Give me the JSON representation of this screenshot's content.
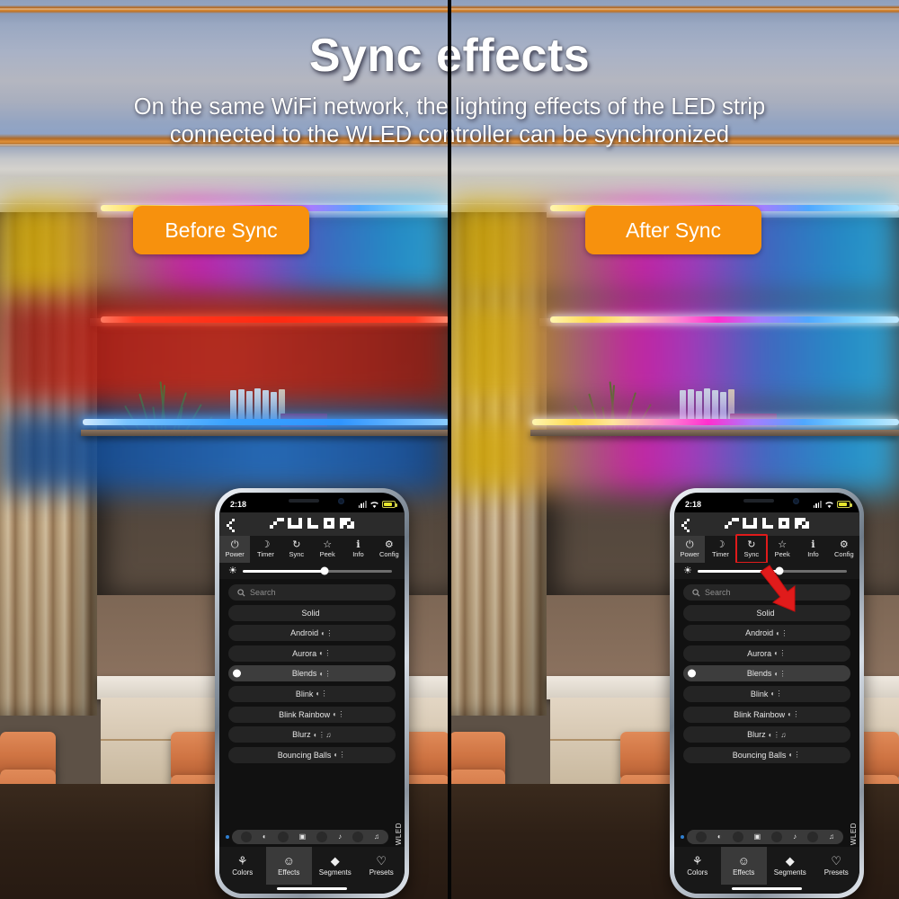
{
  "header": {
    "title": "Sync effects",
    "subtitle_line1": "On the same WiFi network, the lighting effects of the LED strip",
    "subtitle_line2": "connected to the WLED controller can be synchronized"
  },
  "badges": {
    "before": "Before Sync",
    "after": "After Sync"
  },
  "colors": {
    "badge_orange": "#f7910d",
    "divider_black": "#050505",
    "arrow_red": "#e01b1b",
    "highlight_red": "#e01b1b",
    "app_background": "#111111",
    "toolbar_background": "#181818",
    "active_tab": "#3a3a3a"
  },
  "phone": {
    "status_bar": {
      "time": "2:18",
      "signal_icon": "cellular-signal-icon",
      "wifi_icon": "wifi-icon",
      "battery_icon": "battery-icon"
    },
    "app_bar": {
      "back_icon": "back-chevron-icon",
      "logo_text": "WLED"
    },
    "toolbar": [
      {
        "label": "Power",
        "icon": "power-icon",
        "glyph": "⏻",
        "active": true
      },
      {
        "label": "Timer",
        "icon": "moon-icon",
        "glyph": "☽",
        "active": false
      },
      {
        "label": "Sync",
        "icon": "sync-icon",
        "glyph": "↻",
        "active": false
      },
      {
        "label": "Peek",
        "icon": "star-icon",
        "glyph": "☆",
        "active": false
      },
      {
        "label": "Info",
        "icon": "info-icon",
        "glyph": "ℹ",
        "active": false
      },
      {
        "label": "Config",
        "icon": "gear-icon",
        "glyph": "⚙",
        "active": false
      }
    ],
    "brightness": {
      "icon": "brightness-gear-icon",
      "value_percent": 55
    },
    "search": {
      "placeholder": "Search",
      "icon": "search-icon"
    },
    "effects": [
      {
        "name": "Solid",
        "tags": "",
        "selected": false
      },
      {
        "name": "Android",
        "tags": "◐⋮",
        "selected": false
      },
      {
        "name": "Aurora",
        "tags": "◐⋮",
        "selected": false
      },
      {
        "name": "Blends",
        "tags": "◐⋮",
        "selected": true
      },
      {
        "name": "Blink",
        "tags": "◐⋮",
        "selected": false
      },
      {
        "name": "Blink Rainbow",
        "tags": "◐⋮",
        "selected": false
      },
      {
        "name": "Blurz",
        "tags": "◐⋮♫",
        "selected": false
      },
      {
        "name": "Bouncing Balls",
        "tags": "◐⋮",
        "selected": false
      }
    ],
    "filter_bar": {
      "icons": [
        "palette-filter-icon",
        "square-filter-icon",
        "note-filter-icon",
        "music-filter-icon"
      ],
      "glyphs": [
        "◐",
        "▣",
        "♪",
        "♫"
      ]
    },
    "side_label": "WLED",
    "nav": [
      {
        "label": "Colors",
        "icon": "palette-icon",
        "glyph": "⚘",
        "active": false
      },
      {
        "label": "Effects",
        "icon": "smiley-icon",
        "glyph": "☺",
        "active": true
      },
      {
        "label": "Segments",
        "icon": "layers-icon",
        "glyph": "◆",
        "active": false
      },
      {
        "label": "Presets",
        "icon": "heart-icon",
        "glyph": "♡",
        "active": false
      }
    ]
  },
  "annotations": {
    "sync_highlight_box": "sync-button-highlight",
    "red_arrow": "red-pointer-arrow"
  },
  "scene": {
    "left_strips": [
      {
        "name": "top-strip",
        "synced": false
      },
      {
        "name": "middle-strip",
        "synced": false
      },
      {
        "name": "bottom-strip",
        "synced": false
      }
    ],
    "right_strips": [
      {
        "name": "top-strip",
        "synced": true
      },
      {
        "name": "middle-strip",
        "synced": true
      },
      {
        "name": "bottom-strip",
        "synced": true
      }
    ]
  }
}
